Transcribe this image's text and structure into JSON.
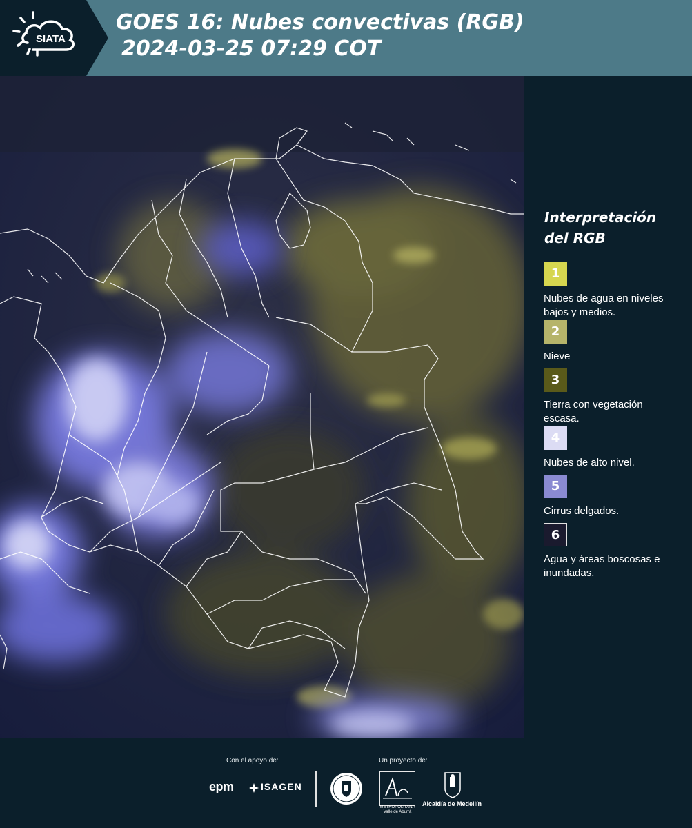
{
  "header": {
    "logo_text": "SIATA",
    "title_line1": "GOES 16: Nubes convectivas (RGB)",
    "title_line2": "2024-03-25 07:29 COT"
  },
  "legend": {
    "title_line1": "Interpretación",
    "title_line2": "del RGB",
    "items": [
      {
        "number": "1",
        "label": "Nubes de agua en niveles bajos y medios.",
        "color": "#d6d64f"
      },
      {
        "number": "2",
        "label": "Nieve",
        "color": "#b6b46a"
      },
      {
        "number": "3",
        "label": "Tierra con vegetación escasa.",
        "color": "#5a5a1a"
      },
      {
        "number": "4",
        "label": "Nubes de alto nivel.",
        "color": "#dcdcf4"
      },
      {
        "number": "5",
        "label": "Cirrus delgados.",
        "color": "#8a8ad2"
      },
      {
        "number": "6",
        "label": "Agua y áreas boscosas e inundadas.",
        "color": "#1a1a2e"
      }
    ]
  },
  "footer": {
    "support_label": "Con el apoyo de:",
    "project_label": "Un proyecto de:",
    "sponsor1": "epm",
    "sponsor2": "ISAGEN",
    "partner_amva_line1": "METROPOLITANA",
    "partner_amva_line2": "Valle de Aburrá",
    "partner_alcaldia": "Alcaldía de Medellín"
  },
  "colors": {
    "header_bg": "#4d7a88",
    "page_bg": "#0b1f2b",
    "ocean_dark": "#1b2447",
    "high_cloud": "#dcdcf4",
    "low_cloud": "#bdbc5a",
    "border_lines": "#ffffff"
  }
}
